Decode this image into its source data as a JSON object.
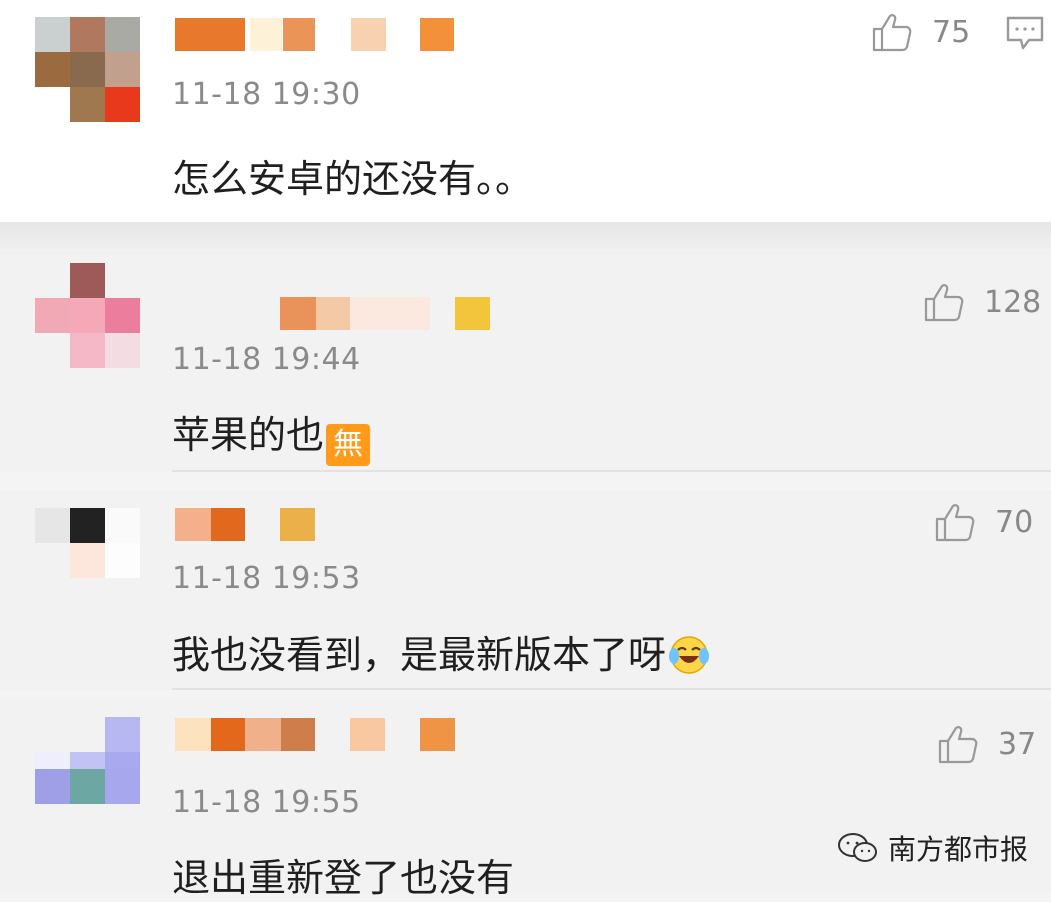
{
  "comments": [
    {
      "time": "11-18 19:30",
      "text": "怎么安卓的还没有。。",
      "likes": "75"
    },
    {
      "time": "11-18 19:44",
      "text": "苹果的也",
      "likes": "128",
      "emoji": "無"
    },
    {
      "time": "11-18 19:53",
      "text": "我也没看到，是最新版本了呀",
      "likes": "70"
    },
    {
      "time": "11-18 19:55",
      "text": "退出重新登了也没有",
      "likes": "37"
    }
  ],
  "watermark": "南方都市报",
  "colors": {
    "text": "#1f1f1f",
    "meta": "#8a8a8a",
    "emoji_badge": "#ff9a1a"
  },
  "icons": [
    "thumbs-up-icon",
    "comment-more-icon",
    "laughing-crying-face-icon",
    "wechat-icon"
  ]
}
